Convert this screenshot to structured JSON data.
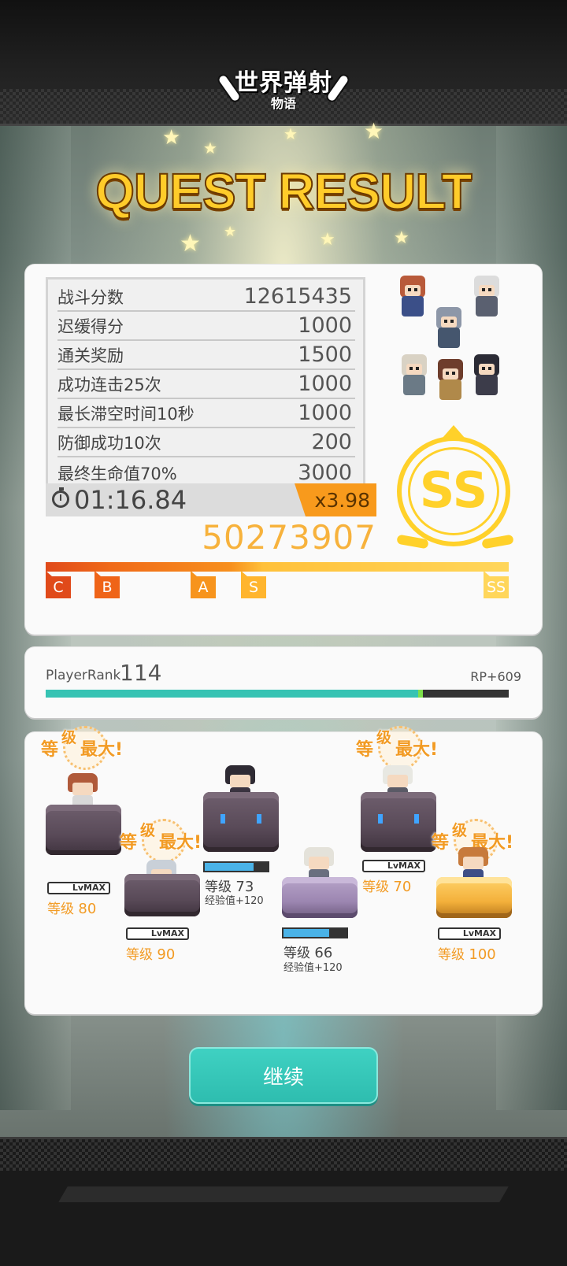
{
  "logo": {
    "line1": "世界弹射",
    "line2": "物语"
  },
  "title": "QUEST RESULT",
  "score_rows": [
    {
      "label": "战斗分数",
      "value": "12615435"
    },
    {
      "label": "迟缓得分",
      "value": "1000"
    },
    {
      "label": "通关奖励",
      "value": "1500"
    },
    {
      "label": "成功连击25次",
      "value": "1000"
    },
    {
      "label": "最长滞空时间10秒",
      "value": "1000"
    },
    {
      "label": "防御成功10次",
      "value": "200"
    },
    {
      "label": "最终生命值70%",
      "value": "3000"
    }
  ],
  "timer": "01:16.84",
  "multiplier": "x3.98",
  "total_score": "50273907",
  "rank": {
    "grade": "SS",
    "progress": 1.0,
    "markers": [
      "C",
      "B",
      "A",
      "S",
      "SS"
    ]
  },
  "player_rank": {
    "label": "PlayerRank",
    "value": "114",
    "rp": "RP+609",
    "progress": 0.81,
    "gain_position": 0.81
  },
  "max_badge": {
    "t1": "等",
    "t2": "级",
    "t3": "最大!"
  },
  "units": [
    {
      "status": "LvMAX",
      "level_label": "等级",
      "level": "80",
      "exp": "",
      "is_max": true,
      "exp_progress": 1.0
    },
    {
      "status": "LvMAX",
      "level_label": "等级",
      "level": "90",
      "exp": "",
      "is_max": true,
      "exp_progress": 1.0
    },
    {
      "status": "",
      "level_label": "等级",
      "level": "73",
      "exp": "经验值+120",
      "is_max": false,
      "exp_progress": 0.78
    },
    {
      "status": "",
      "level_label": "等级",
      "level": "66",
      "exp": "经验值+120",
      "is_max": false,
      "exp_progress": 0.72
    },
    {
      "status": "LvMAX",
      "level_label": "等级",
      "level": "70",
      "exp": "",
      "is_max": true,
      "exp_progress": 1.0
    },
    {
      "status": "LvMAX",
      "level_label": "等级",
      "level": "100",
      "exp": "",
      "is_max": true,
      "exp_progress": 1.0
    }
  ],
  "continue_label": "继续",
  "colors": {
    "accent": "#f29b24",
    "teal": "#36c3b3",
    "gold": "#ffd12a",
    "exp_blue": "#4ab3e8"
  }
}
